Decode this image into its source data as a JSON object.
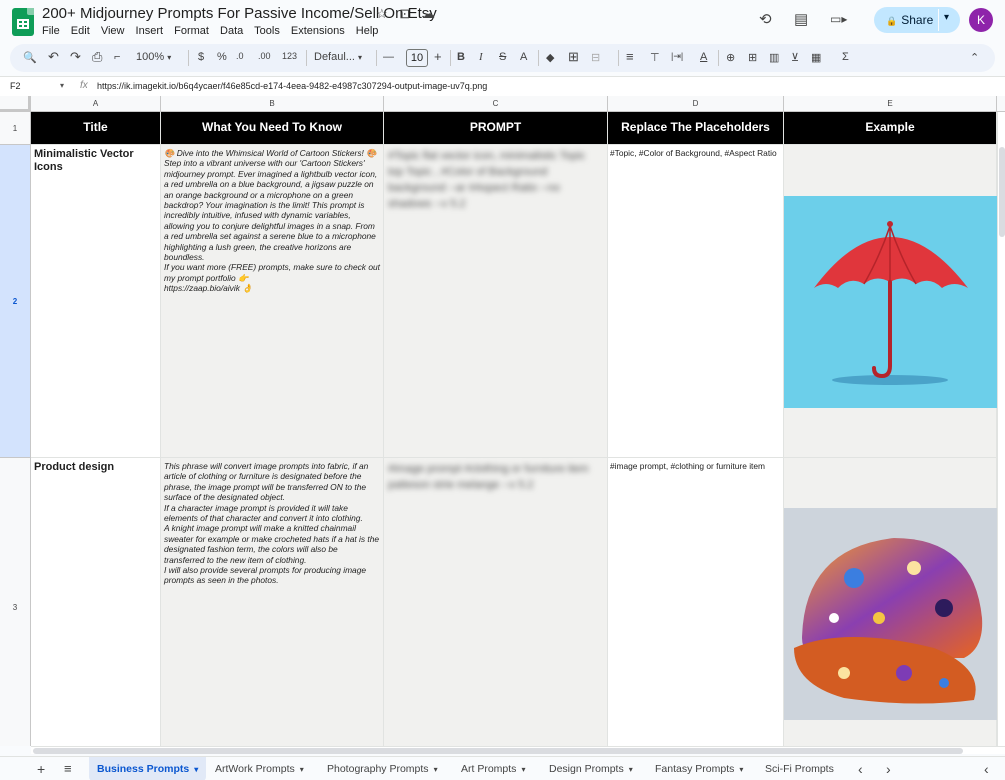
{
  "doc": {
    "title": "200+ Midjourney Prompts For Passive Income/Sell On Etsy",
    "star_icon": "☆",
    "move_icon": "⊡",
    "cloud_icon": "☁"
  },
  "menu": [
    "File",
    "Edit",
    "View",
    "Insert",
    "Format",
    "Data",
    "Tools",
    "Extensions",
    "Help"
  ],
  "header_actions": {
    "history_icon": "⟲",
    "comment_icon": "▤",
    "meet_icon": "▭▸",
    "share_label": "Share",
    "share_caret": "▾",
    "lock_icon": "🔒",
    "avatar_letter": "K"
  },
  "toolbar": {
    "search": "🔍",
    "undo": "↶",
    "redo": "↷",
    "print": "⎙",
    "paint": "⌐",
    "zoom": "100%",
    "zoom_caret": "▾",
    "currency": "$",
    "percent": "%",
    "dec_minus": ".0",
    "dec_plus": ".00",
    "num_fmt": "123",
    "font": "Defaul...",
    "font_caret": "▾",
    "minus": "—",
    "font_size": "10",
    "plus": "+",
    "bold": "B",
    "italic": "I",
    "strike": "S",
    "text_color": "A",
    "fill": "◆",
    "borders": "⊞",
    "merge": "⊟",
    "align": "≡",
    "valign": "⊤",
    "wrap": "|⇥|",
    "rotate": "A",
    "link": "⊕",
    "comment": "⊞",
    "chart": "▥",
    "filter": "⊻",
    "views": "▦",
    "functions": "Σ",
    "collapse": "⌃"
  },
  "formula_bar": {
    "cell_ref": "F2",
    "caret": "▾",
    "fx": "fx",
    "formula": "https://ik.imagekit.io/b6q4ycaer/f46e85cd-e174-4eea-9482-e4987c307294-output-image-uv7q.png"
  },
  "columns": [
    "A",
    "B",
    "C",
    "D",
    "E"
  ],
  "rows": [
    "1",
    "2",
    "3"
  ],
  "table": {
    "headers": [
      "Title",
      "What You Need To Know",
      "PROMPT",
      "Replace The Placeholders",
      "Example"
    ],
    "rows": [
      {
        "title": "Minimalistic Vector Icons",
        "description": "🎨 Dive into the Whimsical World of Cartoon Stickers! 🎨\nStep into a vibrant universe with our 'Cartoon Stickers' midjourney prompt. Ever imagined a lightbulb vector icon, a red umbrella on a blue background, a jigsaw puzzle on an orange background or a microphone on a green backdrop? Your imagination is the limit! This prompt is incredibly intuitive, infused with dynamic variables, allowing you to conjure delightful images in a snap. From a red umbrella set against a serene blue to a microphone highlighting a lush green, the creative horizons are boundless.\nIf you want more (FREE) prompts, make sure to check out my prompt portfolio 👉\nhttps://zaap.bio/aivik 👌",
        "prompt": "#Topic flat vector icon, minimalistic Topic top Topic , #Color of Background background --ar #Aspect Ratio --no shadows --v 5.2",
        "placeholders": "#Topic, #Color of Background, #Aspect Ratio",
        "example": "red umbrella on blue background"
      },
      {
        "title": "Product design",
        "description": "This phrase will convert image prompts into fabric, if an article of clothing or furniture is designated before the phrase, the image prompt will be transferred ON to the surface of the designated object.\nIf a character image prompt is provided it will take elements of that character and convert it into clothing.\nA knight image prompt will make a knitted chainmail sweater for example or make crocheted hats if a hat is the designated fashion term, the colors will also be transferred to the new item of clothing.\nI will also provide several prompts for producing image prompts as seen in the photos.",
        "prompt": "#image prompt #clothing or furniture item patteson strie melange --v 5.2",
        "placeholders": "#image prompt, #clothing or furniture item",
        "example": "colorful patterned cap"
      }
    ]
  },
  "sheet_tabs": {
    "add": "+",
    "list": "≡",
    "tabs": [
      "Business Prompts",
      "ArtWork Prompts",
      "Photography Prompts",
      "Art Prompts",
      "Design Prompts",
      "Fantasy Prompts",
      "Sci-Fi Prompts"
    ],
    "caret": "▾",
    "nav_left": "‹",
    "nav_right": "›",
    "collapse": "‹"
  }
}
